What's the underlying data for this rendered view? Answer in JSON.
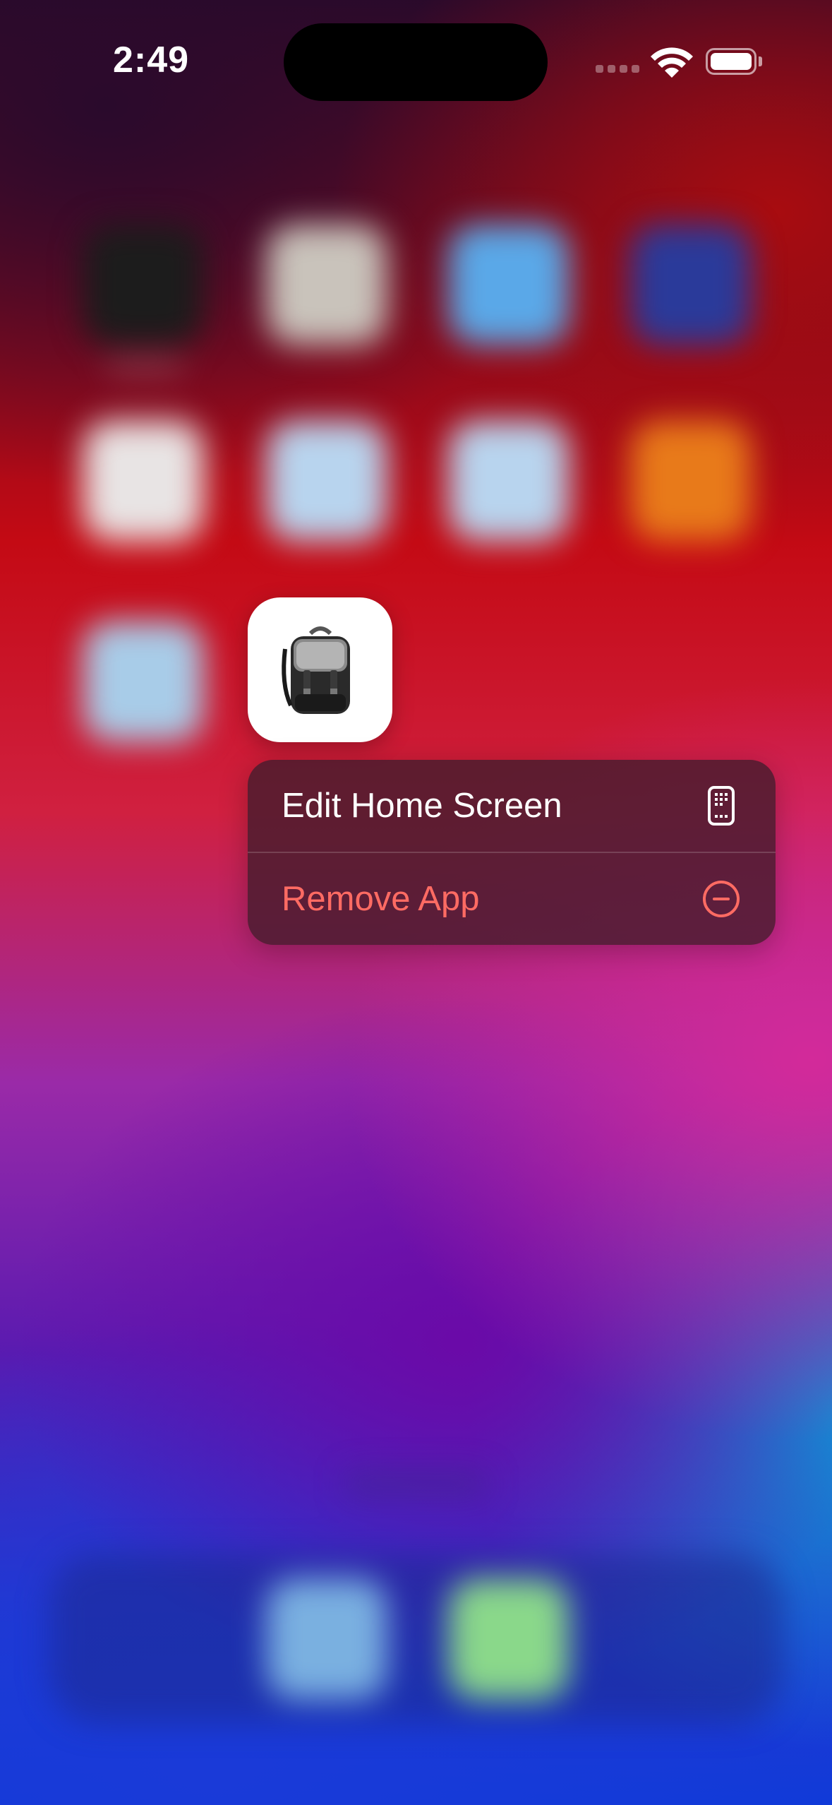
{
  "status_bar": {
    "time": "2:49",
    "wifi_icon": "wifi-icon",
    "battery_icon": "battery-icon"
  },
  "focused_app": {
    "icon": "backpack-app-icon"
  },
  "context_menu": {
    "items": [
      {
        "label": "Edit Home Screen",
        "icon": "phone-apps-icon",
        "style": "normal",
        "color": "#ffffff"
      },
      {
        "label": "Remove App",
        "icon": "minus-circle-icon",
        "style": "destructive",
        "color": "#ff6b63"
      }
    ]
  }
}
